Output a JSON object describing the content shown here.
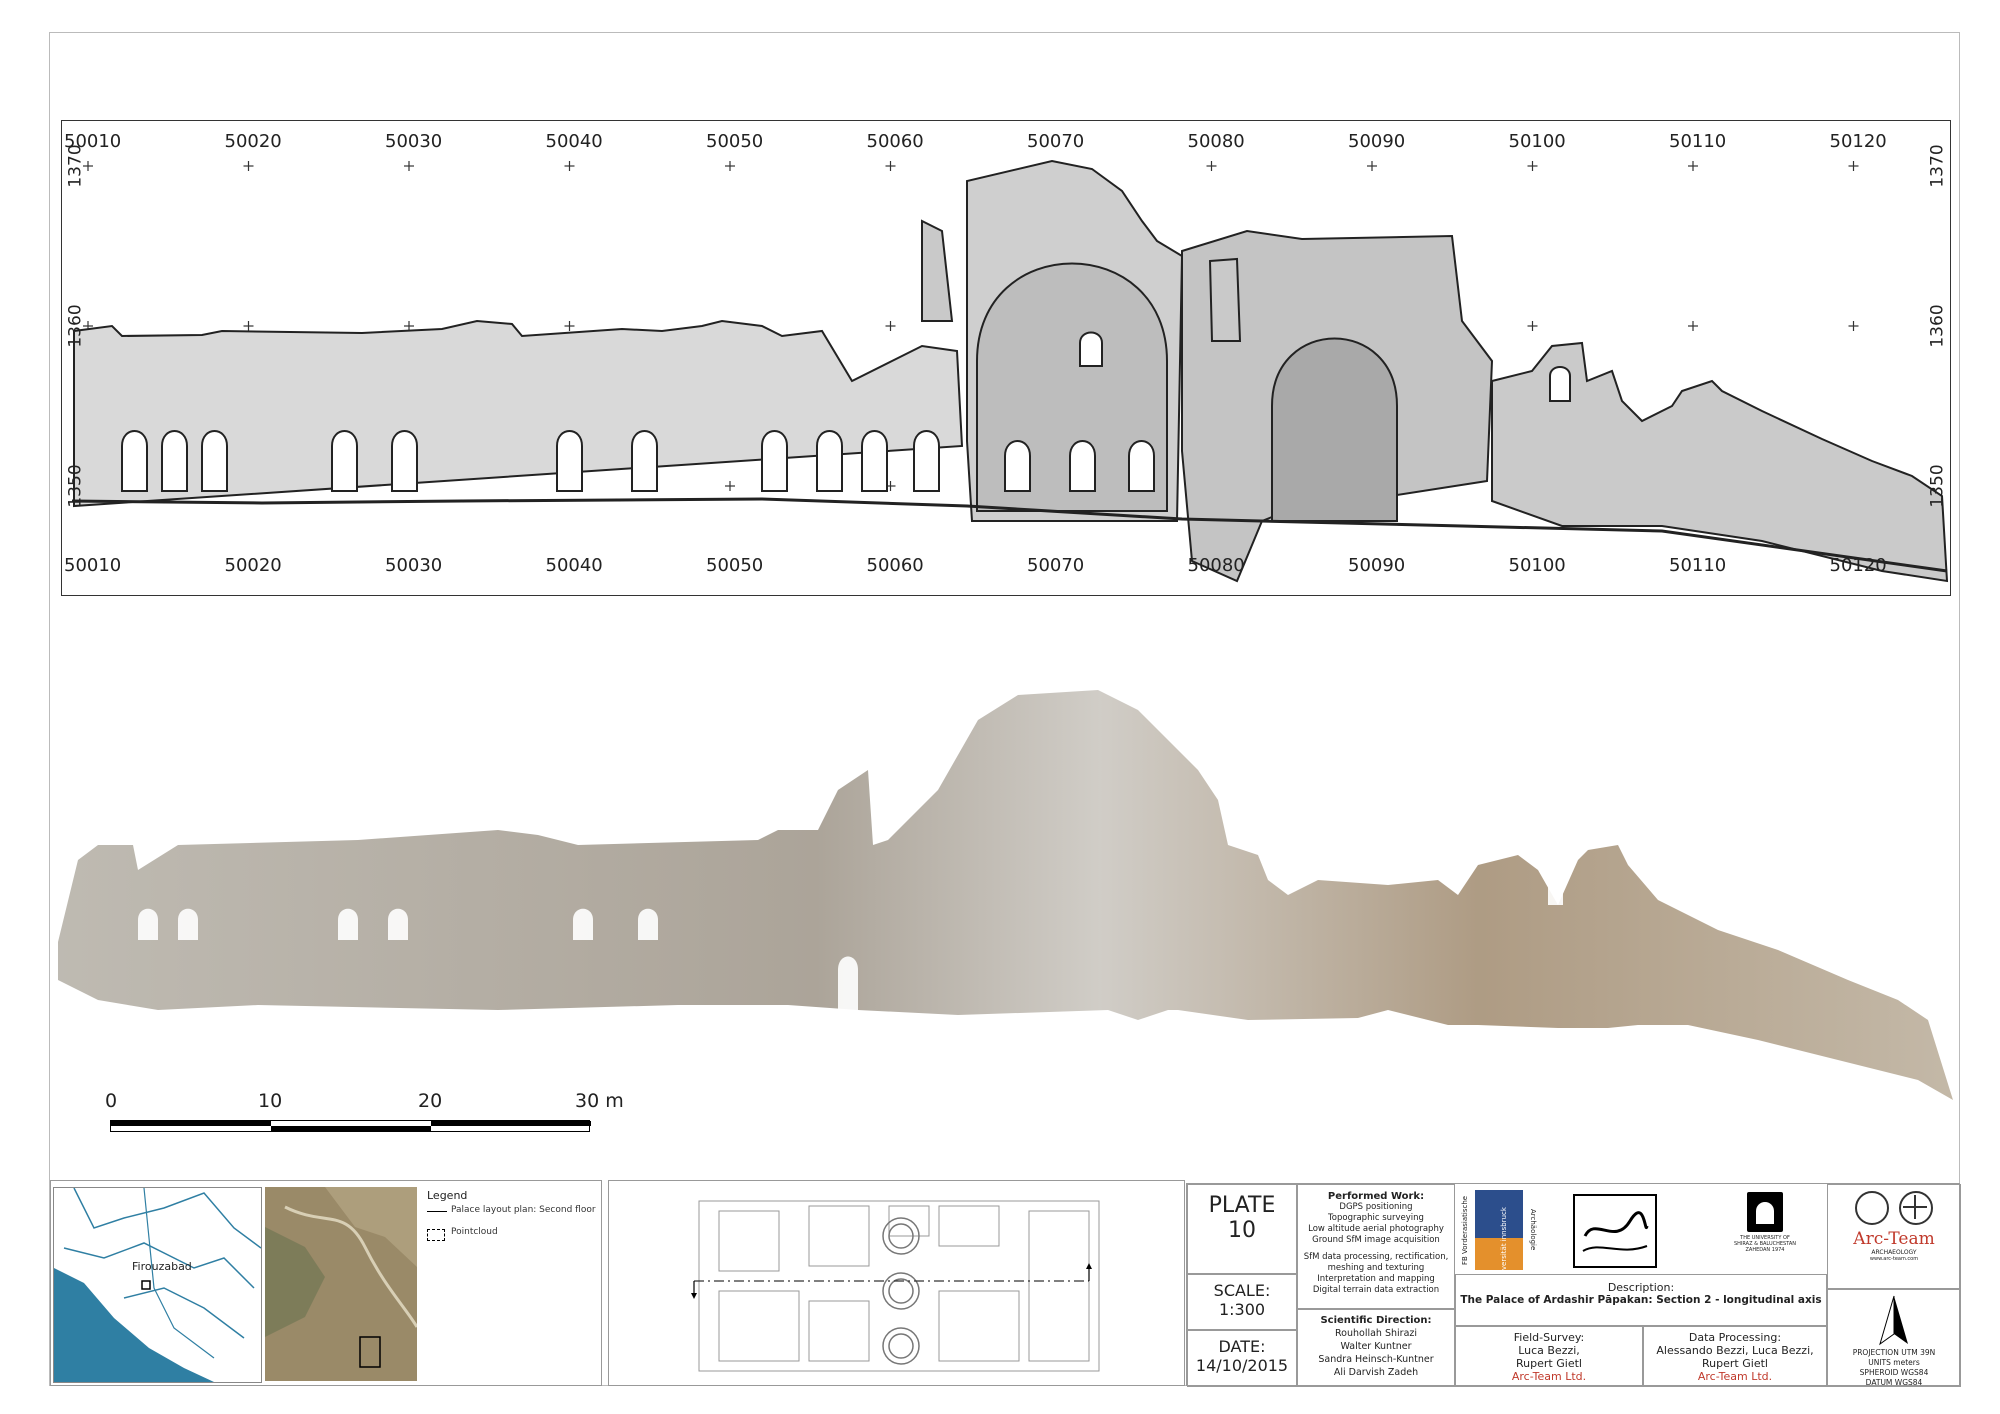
{
  "section_drawing": {
    "x_ticks": [
      "50010",
      "50020",
      "50030",
      "50040",
      "50050",
      "50060",
      "50070",
      "50080",
      "50090",
      "50100",
      "50110",
      "50120"
    ],
    "elevation_ticks": [
      "1370",
      "1360",
      "1350"
    ]
  },
  "scale_bar": {
    "labels": [
      "0",
      "10",
      "20",
      "30 m"
    ]
  },
  "legend": {
    "title": "Legend",
    "items": [
      "Palace layout plan: Second floor",
      "Pointcloud"
    ],
    "map_place": "Firouzabad"
  },
  "plate": {
    "label": "PLATE",
    "number": "10",
    "scale_label": "SCALE:",
    "scale_value": "1:300",
    "date_label": "DATE:",
    "date_value": "14/10/2015"
  },
  "performed_work": {
    "title": "Performed Work:",
    "lines_a": [
      "DGPS positioning",
      "Topographic surveying",
      "Low altitude aerial photography",
      "Ground SfM image acquisition"
    ],
    "lines_b": [
      "SfM data processing, rectification,",
      "meshing and texturing",
      "Interpretation and mapping",
      "Digital terrain data extraction"
    ]
  },
  "scientific_direction": {
    "title": "Scientific Direction:",
    "names": [
      "Rouhollah Shirazi",
      "Walter Kuntner",
      "Sandra Heinsch-Kuntner",
      "Ali Darvish Zadeh"
    ]
  },
  "description": {
    "label": "Description:",
    "text": "The Palace of Ardashir Pāpakan: Section 2 - longitudinal axis"
  },
  "field_survey": {
    "label": "Field-Survey:",
    "names": [
      "Luca Bezzi,",
      "Rupert Gietl"
    ],
    "company": "Arc-Team Ltd."
  },
  "data_processing": {
    "label": "Data Processing:",
    "names": [
      "Alessando Bezzi, Luca Bezzi,",
      "Rupert Gietl"
    ],
    "company": "Arc-Team Ltd."
  },
  "logos": {
    "innsbruck_side": "Archäologie",
    "innsbruck_side2": "FB Vorderasiatische",
    "innsbruck_main": "universität innsbruck",
    "university_lines": [
      "THE UNIVERSITY OF",
      "SHIRAZ & BALUCHESTAN",
      "ZAHEDAN 1974"
    ],
    "arcteam": "Arc-Team",
    "arcteam_sub": "ARCHAEOLOGY",
    "arcteam_url": "www.arc-team.com"
  },
  "projection": {
    "line1": "PROJECTION UTM 39N",
    "line2": "UNITS meters",
    "line3": "SPHEROID WGS84",
    "line4": "DATUM WGS84"
  },
  "colors": {
    "accent_red": "#c0392b",
    "sea_blue": "#2f7fa3",
    "aerial": "#8a7a5a"
  }
}
